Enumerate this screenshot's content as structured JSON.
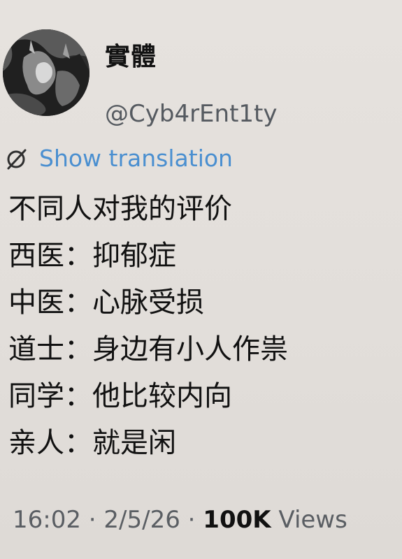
{
  "user": {
    "display_name": "實體",
    "handle": "@Cyb4rEnt1ty"
  },
  "translation": {
    "icon": "translate-icon",
    "label": "Show translation",
    "color": "#4a8fd0"
  },
  "tweet": {
    "lines": [
      "不同人对我的评价",
      "西医：抑郁症",
      "中医：心脉受损",
      "道士：身边有小人作祟",
      "同学：他比较内向",
      "亲人：就是闲"
    ]
  },
  "meta": {
    "time": "16:02",
    "separator": " · ",
    "date": "2/5/26",
    "views_count": "100K",
    "views_label": " Views"
  }
}
